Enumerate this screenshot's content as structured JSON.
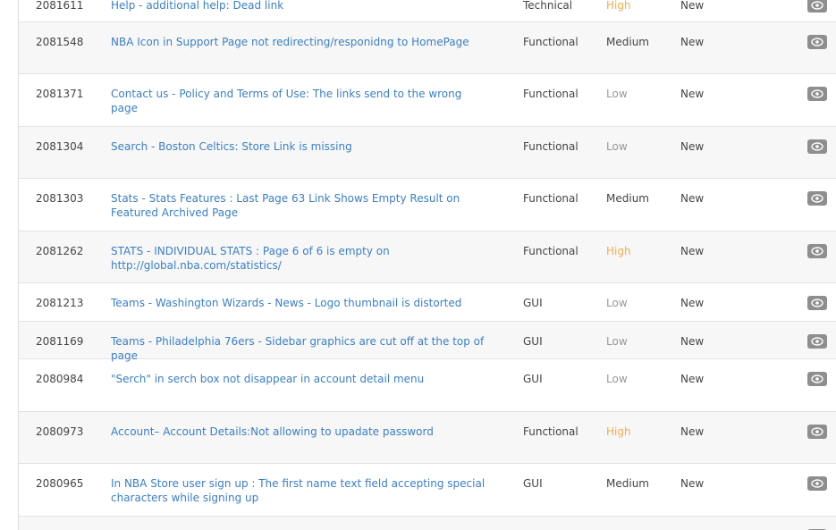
{
  "bugs": [
    {
      "id": "2081611",
      "title": "Help - additional help: Dead link",
      "type": "Technical",
      "severity": "High",
      "status": "New",
      "height": 41
    },
    {
      "id": "2081548",
      "title": "NBA Icon in Support Page not redirecting/responidng to HomePage",
      "type": "Functional",
      "severity": "Medium",
      "status": "New",
      "height": 58
    },
    {
      "id": "2081371",
      "title": "Contact us - Policy and Terms of Use: The links send to the wrong page",
      "type": "Functional",
      "severity": "Low",
      "status": "New",
      "height": 59
    },
    {
      "id": "2081304",
      "title": "Search - Boston Celtics: Store Link is missing",
      "type": "Functional",
      "severity": "Low",
      "status": "New",
      "height": 58
    },
    {
      "id": "2081303",
      "title": "Stats - Stats Features : Last Page 63 Link Shows Empty Result on Featured Archived Page",
      "type": "Functional",
      "severity": "Medium",
      "status": "New",
      "height": 59
    },
    {
      "id": "2081262",
      "title": "STATS - INDIVIDUAL STATS : Page 6 of 6 is empty on http://global.nba.com/statistics/",
      "type": "Functional",
      "severity": "High",
      "status": "New",
      "height": 58
    },
    {
      "id": "2081213",
      "title": "Teams - Washington Wizards - News - Logo thumbnail is distorted",
      "type": "GUI",
      "severity": "Low",
      "status": "New",
      "height": 43
    },
    {
      "id": "2081169",
      "title": "Teams - Philadelphia 76ers - Sidebar graphics are cut off at the top of page",
      "type": "GUI",
      "severity": "Low",
      "status": "New",
      "height": 42
    },
    {
      "id": "2080984",
      "title": "\"Serch\" in serch box not disappear in account detail menu",
      "type": "GUI",
      "severity": "Low",
      "status": "New",
      "height": 59
    },
    {
      "id": "2080973",
      "title": "Account– Account Details:Not allowing to upadate password",
      "type": "Functional",
      "severity": "High",
      "status": "New",
      "height": 58
    },
    {
      "id": "2080965",
      "title": "In NBA Store user sign up : The first name text field accepting special characters while signing up",
      "type": "GUI",
      "severity": "Medium",
      "status": "New",
      "height": 59
    },
    {
      "id": "",
      "title": "",
      "type": "",
      "severity": "",
      "status": "",
      "height": 40
    }
  ],
  "icons": {
    "action_badge": "eye-icon"
  },
  "colors": {
    "link": "#3b7fc4",
    "high": "#f0ad4e",
    "low": "#999999",
    "badge": "#8e8e8e"
  }
}
